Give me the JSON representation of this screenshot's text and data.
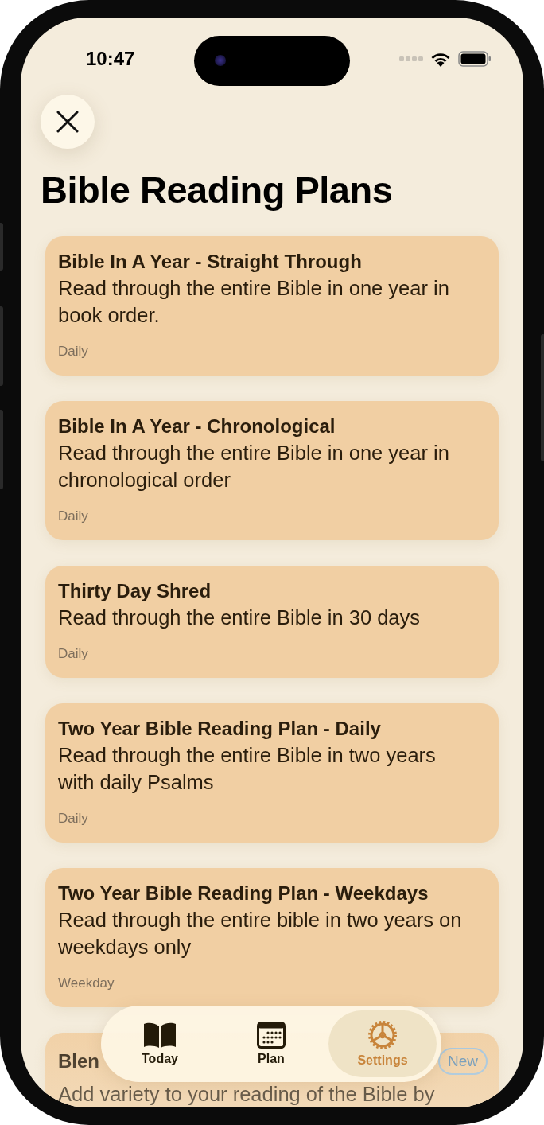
{
  "status_bar": {
    "time": "10:47"
  },
  "title": "Bible Reading Plans",
  "plans": [
    {
      "title": "Bible In A Year - Straight Through",
      "description": "Read through the entire Bible in one year in book order.",
      "frequency": "Daily"
    },
    {
      "title": "Bible In A Year - Chronological",
      "description": "Read through the entire Bible in one year in chronological order",
      "frequency": "Daily"
    },
    {
      "title": "Thirty Day Shred",
      "description": "Read through the entire Bible in 30 days",
      "frequency": "Daily"
    },
    {
      "title": "Two Year Bible Reading Plan - Daily",
      "description": "Read through the entire Bible in two years with daily Psalms",
      "frequency": "Daily"
    },
    {
      "title": "Two Year Bible Reading Plan - Weekdays",
      "description": "Read through the entire bible in two years on weekdays only",
      "frequency": "Weekday"
    },
    {
      "title": "Blen",
      "description": "Add variety to your reading of the Bible by",
      "badge": "New"
    }
  ],
  "tab_bar": [
    {
      "label": "Today",
      "selected": false
    },
    {
      "label": "Plan",
      "selected": false
    },
    {
      "label": "Settings",
      "selected": true
    }
  ]
}
